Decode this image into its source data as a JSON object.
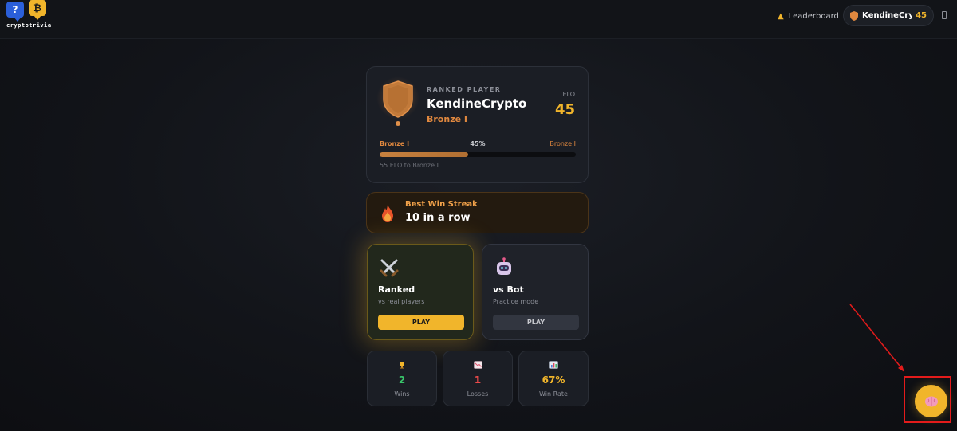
{
  "header": {
    "logo_text": "cryptotrivia",
    "logo_q": "?",
    "logo_b": "₿",
    "leaderboard_label": "Leaderboard",
    "user_name": "KendineCryp",
    "user_elo": "45"
  },
  "profile": {
    "label": "RANKED PLAYER",
    "name": "KendineCrypto",
    "tier": "Bronze I",
    "elo_label": "ELO",
    "elo_value": "45",
    "progress_left": "Bronze I",
    "progress_pct": "45%",
    "progress_value": 0.45,
    "progress_right": "Bronze I",
    "progress_note": "55 ELO to Bronze I"
  },
  "streak": {
    "label": "Best Win Streak",
    "value": "10 in a row"
  },
  "modes": {
    "ranked": {
      "title": "Ranked",
      "subtitle": "vs real players",
      "button": "PLAY"
    },
    "bot": {
      "title": "vs Bot",
      "subtitle": "Practice mode",
      "button": "PLAY"
    }
  },
  "stats": {
    "wins": {
      "value": "2",
      "label": "Wins",
      "icon": "trophy-icon"
    },
    "losses": {
      "value": "1",
      "label": "Losses",
      "icon": "chart-down-icon"
    },
    "rate": {
      "value": "67%",
      "label": "Win Rate",
      "icon": "bar-chart-icon"
    }
  },
  "fab": {
    "icon": "brain-icon"
  },
  "colors": {
    "accent": "#f1b52b",
    "bronze": "#e0883f",
    "win": "#38c46a",
    "loss": "#ec4a4a",
    "annotation": "#e31b1b"
  }
}
